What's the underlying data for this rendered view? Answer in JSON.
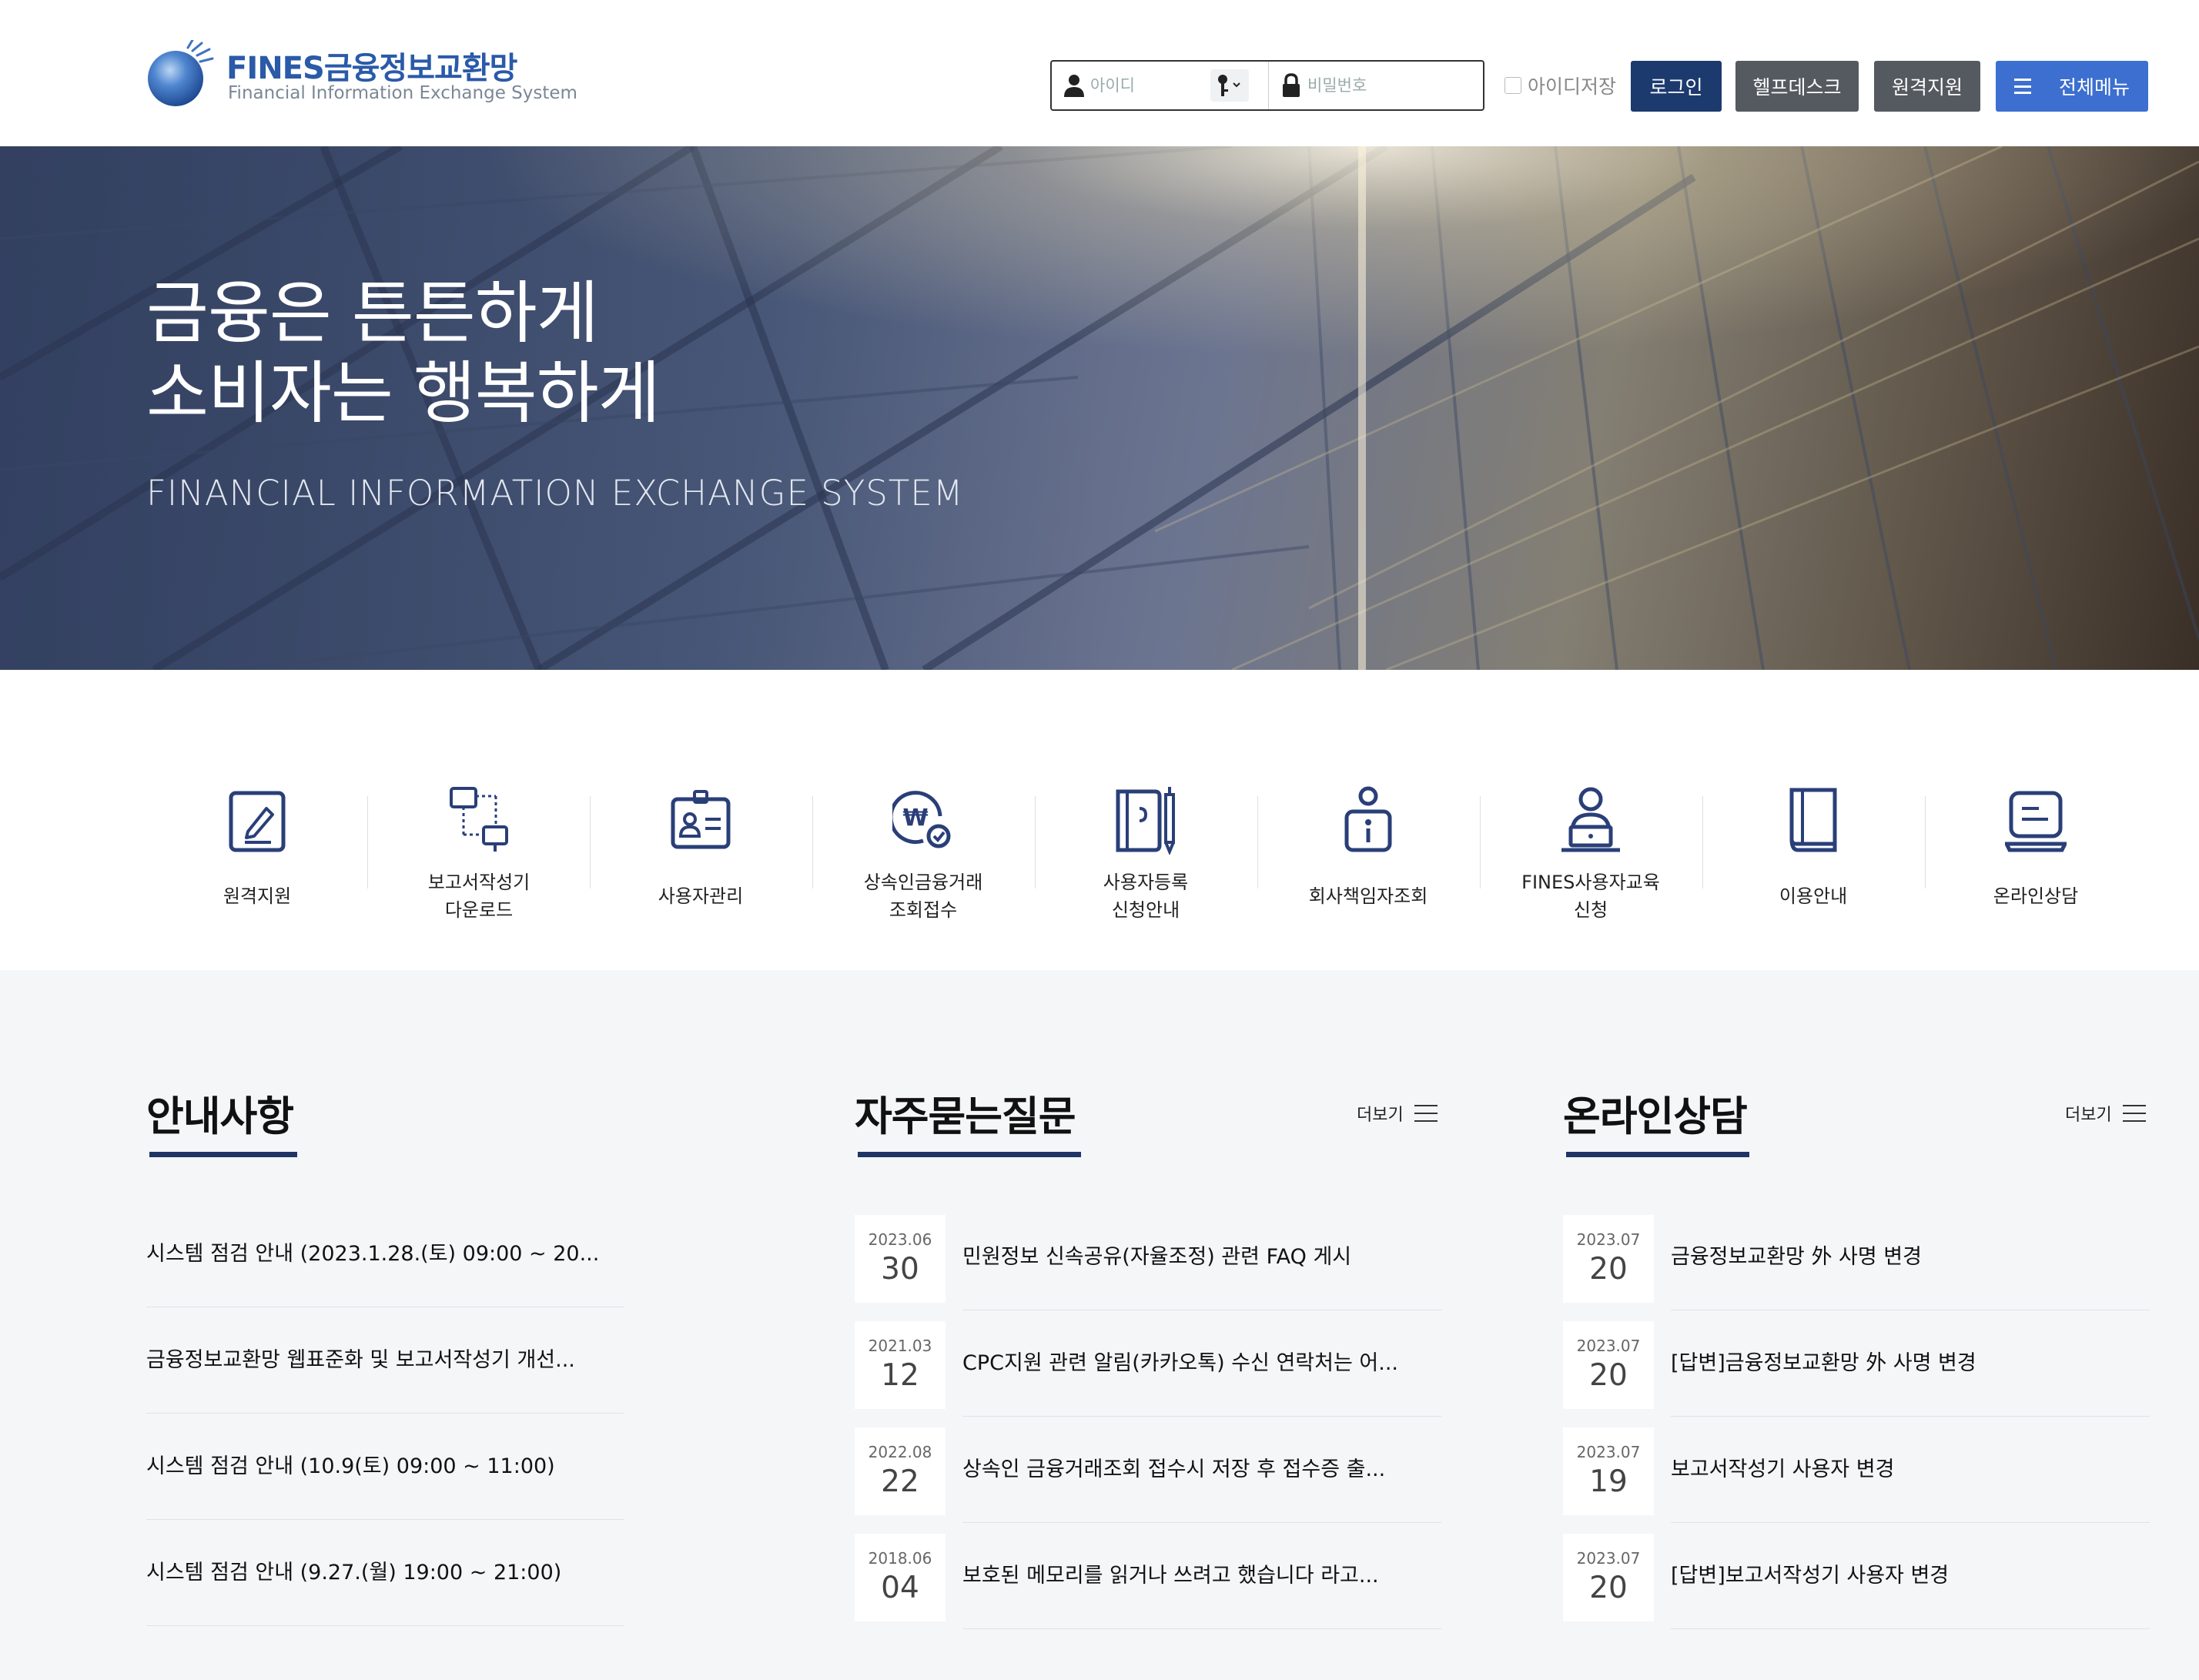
{
  "logo": {
    "title": "FINES금융정보교환망",
    "subtitle": "Financial Information Exchange System"
  },
  "login": {
    "id_placeholder": "아이디",
    "pw_placeholder": "비밀번호",
    "save_id_label": "아이디저장",
    "login_label": "로그인"
  },
  "header_buttons": {
    "helpdesk": "헬프데스크",
    "remote": "원격지원",
    "all_menu": "전체메뉴"
  },
  "hero": {
    "line1": "금융은 튼튼하게",
    "line2": "소비자는 행복하게",
    "subtitle": "FINANCIAL INFORMATION EXCHANGE SYSTEM"
  },
  "quick_menu": [
    {
      "line1": "원격지원",
      "line2": "",
      "icon": "pen-edit-icon"
    },
    {
      "line1": "보고서작성기",
      "line2": "다운로드",
      "icon": "monitor-network-icon"
    },
    {
      "line1": "사용자관리",
      "line2": "",
      "icon": "id-card-icon"
    },
    {
      "line1": "상속인금융거래",
      "line2": "조회접수",
      "icon": "won-search-icon"
    },
    {
      "line1": "사용자등록",
      "line2": "신청안내",
      "icon": "notebook-pen-icon"
    },
    {
      "line1": "회사책임자조회",
      "line2": "",
      "icon": "person-info-icon"
    },
    {
      "line1": "FINES사용자교육",
      "line2": "신청",
      "icon": "user-laptop-icon"
    },
    {
      "line1": "이용안내",
      "line2": "",
      "icon": "book-icon"
    },
    {
      "line1": "온라인상담",
      "line2": "",
      "icon": "chat-laptop-icon"
    }
  ],
  "notices": {
    "title": "안내사항",
    "items": [
      "시스템 점검 안내 (2023.1.28.(토) 09:00 ~ 20...",
      "금융정보교환망 웹표준화 및 보고서작성기 개선...",
      "시스템 점검 안내 (10.9(토) 09:00 ~ 11:00)",
      "시스템 점검 안내 (9.27.(월) 19:00 ~ 21:00)"
    ]
  },
  "faq": {
    "title": "자주묻는질문",
    "more": "더보기",
    "items": [
      {
        "ym": "2023.06",
        "day": "30",
        "text": "민원정보 신속공유(자율조정) 관련 FAQ 게시"
      },
      {
        "ym": "2021.03",
        "day": "12",
        "text": "CPC지원 관련 알림(카카오톡) 수신 연락처는 어..."
      },
      {
        "ym": "2022.08",
        "day": "22",
        "text": "상속인 금융거래조회 접수시 저장 후 접수증 출..."
      },
      {
        "ym": "2018.06",
        "day": "04",
        "text": "보호된 메모리를 읽거나 쓰려고 했습니다 라고..."
      }
    ]
  },
  "consult": {
    "title": "온라인상담",
    "more": "더보기",
    "items": [
      {
        "ym": "2023.07",
        "day": "20",
        "text": "금융정보교환망 外 사명 변경"
      },
      {
        "ym": "2023.07",
        "day": "20",
        "text": "[답변]금융정보교환망 外 사명 변경"
      },
      {
        "ym": "2023.07",
        "day": "19",
        "text": "보고서작성기 사용자 변경"
      },
      {
        "ym": "2023.07",
        "day": "20",
        "text": "[답변]보고서작성기 사용자 변경"
      }
    ]
  },
  "colors": {
    "navy": "#1c3a6e",
    "accent_blue": "#3c6fd0",
    "gray_button": "#555a60",
    "icon_navy": "#2a3f78"
  }
}
